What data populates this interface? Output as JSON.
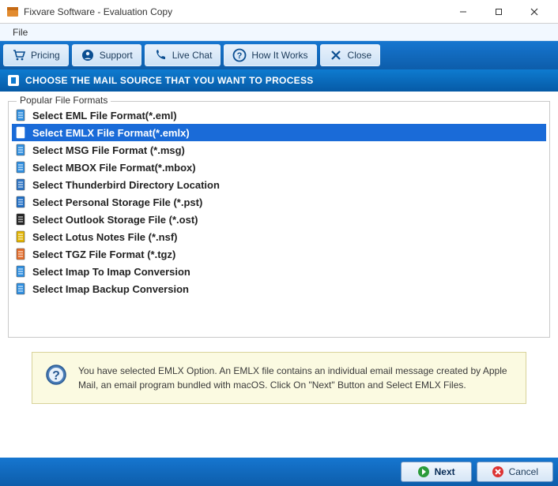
{
  "window": {
    "title": "Fixvare Software - Evaluation Copy"
  },
  "menubar": {
    "file": "File"
  },
  "toolbar": {
    "pricing": "Pricing",
    "support": "Support",
    "livechat": "Live Chat",
    "howitworks": "How It Works",
    "close": "Close"
  },
  "section": {
    "title": "CHOOSE THE MAIL SOURCE THAT YOU WANT TO PROCESS"
  },
  "groupbox": {
    "legend": "Popular File Formats"
  },
  "formats": [
    {
      "label": "Select EML File Format(*.eml)",
      "selected": false,
      "icon_color": "#2f8fe0"
    },
    {
      "label": "Select EMLX File Format(*.emlx)",
      "selected": true,
      "icon_color": "#ffffff"
    },
    {
      "label": "Select MSG File Format (*.msg)",
      "selected": false,
      "icon_color": "#2f8fe0"
    },
    {
      "label": "Select MBOX File Format(*.mbox)",
      "selected": false,
      "icon_color": "#2f8fe0"
    },
    {
      "label": "Select Thunderbird Directory Location",
      "selected": false,
      "icon_color": "#2d74c4"
    },
    {
      "label": "Select Personal Storage File (*.pst)",
      "selected": false,
      "icon_color": "#1f6fc7"
    },
    {
      "label": "Select Outlook Storage File (*.ost)",
      "selected": false,
      "icon_color": "#222222"
    },
    {
      "label": "Select Lotus Notes File (*.nsf)",
      "selected": false,
      "icon_color": "#e3b400"
    },
    {
      "label": "Select TGZ File Format (*.tgz)",
      "selected": false,
      "icon_color": "#e46c2a"
    },
    {
      "label": "Select Imap To Imap Conversion",
      "selected": false,
      "icon_color": "#2f8fe0"
    },
    {
      "label": "Select Imap Backup Conversion",
      "selected": false,
      "icon_color": "#2f8fe0"
    }
  ],
  "info": {
    "text": "You have selected EMLX Option. An EMLX file contains an individual email message created by Apple Mail, an email program bundled with macOS. Click On \"Next\" Button and Select EMLX Files."
  },
  "buttons": {
    "next": "Next",
    "cancel": "Cancel"
  }
}
